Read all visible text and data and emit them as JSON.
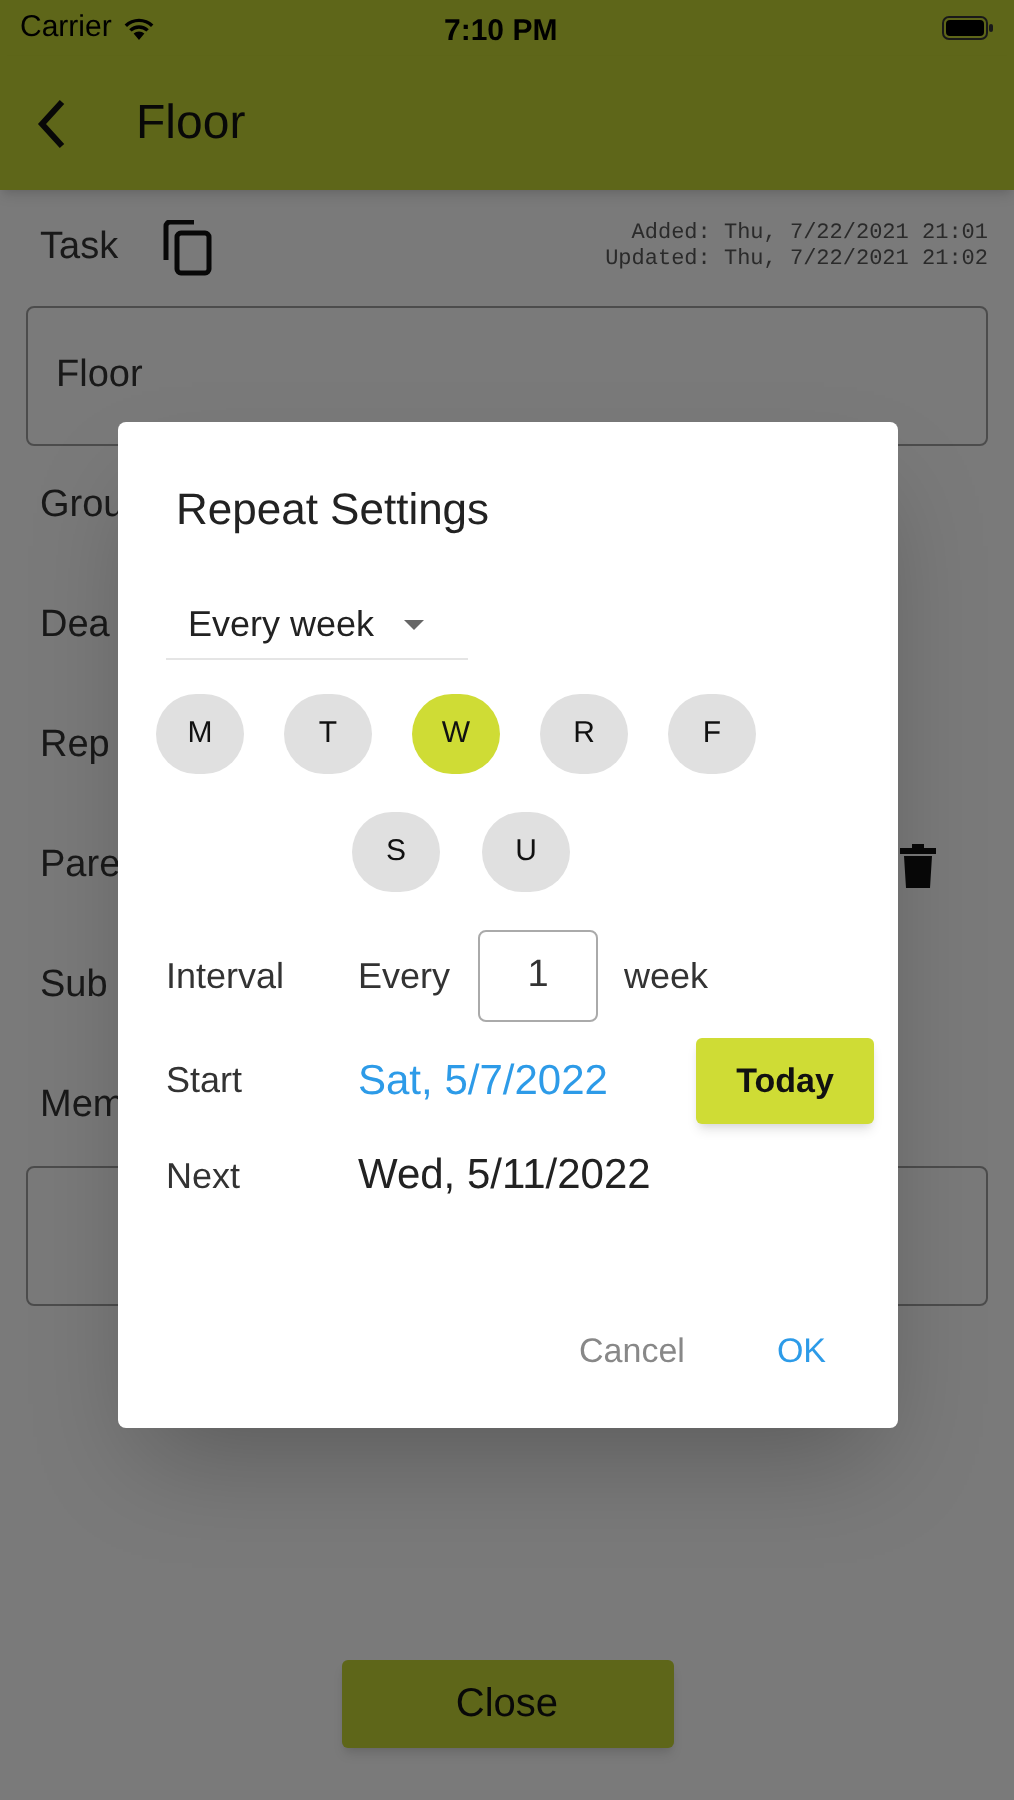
{
  "status_bar": {
    "carrier": "Carrier",
    "time": "7:10 PM"
  },
  "app_bar": {
    "title": "Floor"
  },
  "task": {
    "label": "Task",
    "timestamps": [
      "Added: Thu, 7/22/2021 21:01",
      "Updated: Thu, 7/22/2021 21:02"
    ],
    "value": "Floor"
  },
  "fields": [
    {
      "label": "Grou",
      "kind": "plain"
    },
    {
      "label": "Dea",
      "kind": "plain"
    },
    {
      "label": "Rep",
      "kind": "plain"
    },
    {
      "label": "Pare",
      "kind": "trash"
    },
    {
      "label": "Sub",
      "kind": "plain"
    },
    {
      "label": "Mem",
      "kind": "memo"
    }
  ],
  "close_button": "Close",
  "dialog": {
    "title": "Repeat Settings",
    "frequency": "Every week",
    "days": [
      {
        "label": "M",
        "selected": false
      },
      {
        "label": "T",
        "selected": false
      },
      {
        "label": "W",
        "selected": true
      },
      {
        "label": "R",
        "selected": false
      },
      {
        "label": "F",
        "selected": false
      },
      {
        "label": "S",
        "selected": false
      },
      {
        "label": "U",
        "selected": false
      }
    ],
    "interval": {
      "label": "Interval",
      "prefix": "Every",
      "value": "1",
      "unit": "week"
    },
    "start": {
      "label": "Start",
      "value": "Sat, 5/7/2022",
      "button": "Today"
    },
    "next": {
      "label": "Next",
      "value": "Wed, 5/11/2022"
    },
    "actions": [
      "Cancel",
      "OK"
    ]
  }
}
